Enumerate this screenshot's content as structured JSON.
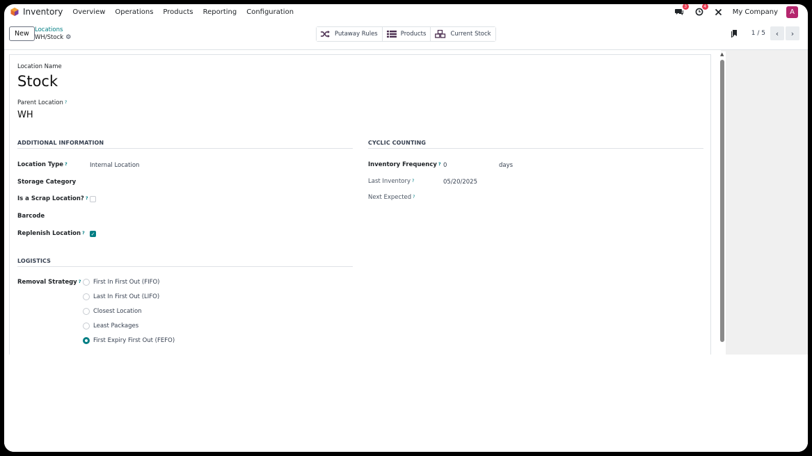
{
  "navbar": {
    "app_name": "Inventory",
    "menu": [
      "Overview",
      "Operations",
      "Products",
      "Reporting",
      "Configuration"
    ],
    "messages_badge": "3",
    "activities_badge": "4",
    "company": "My Company",
    "avatar_letter": "A"
  },
  "control": {
    "new_label": "New",
    "breadcrumb_parent": "Locations",
    "breadcrumb_current": "WH/Stock",
    "smart_buttons": [
      "Putaway Rules",
      "Products",
      "Current Stock"
    ],
    "pager": "1 / 5"
  },
  "form": {
    "location_name_label": "Location Name",
    "location_name": "Stock",
    "parent_label": "Parent Location",
    "parent_value": "WH",
    "additional": {
      "heading": "ADDITIONAL INFORMATION",
      "location_type_label": "Location Type",
      "location_type_value": "Internal Location",
      "storage_category_label": "Storage Category",
      "scrap_label": "Is a Scrap Location?",
      "scrap_checked": false,
      "barcode_label": "Barcode",
      "replenish_label": "Replenish Location",
      "replenish_checked": true
    },
    "cyclic": {
      "heading": "CYCLIC COUNTING",
      "frequency_label": "Inventory Frequency",
      "frequency_value": "0",
      "frequency_unit": "days",
      "last_label": "Last Inventory",
      "last_value": "05/20/2025",
      "next_label": "Next Expected"
    },
    "logistics": {
      "heading": "LOGISTICS",
      "removal_label": "Removal Strategy",
      "options": [
        "First In First Out (FIFO)",
        "Last In First Out (LIFO)",
        "Closest Location",
        "Least Packages",
        "First Expiry First Out (FEFO)"
      ],
      "selected": "First Expiry First Out (FEFO)"
    }
  },
  "colors": {
    "accent": "#017e84",
    "badge": "#e8384f",
    "avatar": "#b5266e"
  }
}
